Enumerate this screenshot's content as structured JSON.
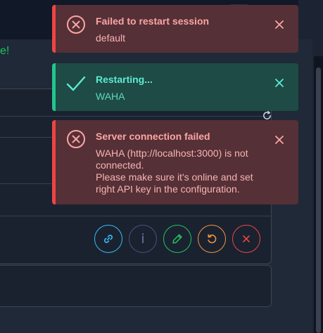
{
  "background": {
    "partial_text": "e!"
  },
  "toasts": [
    {
      "type": "error",
      "title": "Failed to restart session",
      "message": "default",
      "icon": "error-circle-icon",
      "close_icon": "close-icon"
    },
    {
      "type": "success",
      "title": "Restarting...",
      "message": "WAHA",
      "icon": "checkmark-icon",
      "close_icon": "close-icon"
    },
    {
      "type": "error",
      "title": "Server connection failed",
      "message_lines": [
        "WAHA (http://localhost:3000) is not connected.",
        "Please make sure it's online and set right API key in the configuration."
      ],
      "icon": "error-circle-icon",
      "close_icon": "close-icon"
    }
  ],
  "session_actions": [
    {
      "name": "link-button",
      "icon": "link-icon",
      "color": "#38bdf8"
    },
    {
      "name": "info-button",
      "icon": "info-icon",
      "glyph": "i",
      "color": "#6a72a4"
    },
    {
      "name": "edit-button",
      "icon": "pencil-icon",
      "color": "#22c55e"
    },
    {
      "name": "restart-button",
      "icon": "restart-icon",
      "color": "#fb923c"
    },
    {
      "name": "stop-button",
      "icon": "close-icon",
      "color": "#ef4444"
    }
  ],
  "colors": {
    "error_accent": "#ef4444",
    "success_accent": "#22c58e",
    "page_background": "#1c2433"
  }
}
